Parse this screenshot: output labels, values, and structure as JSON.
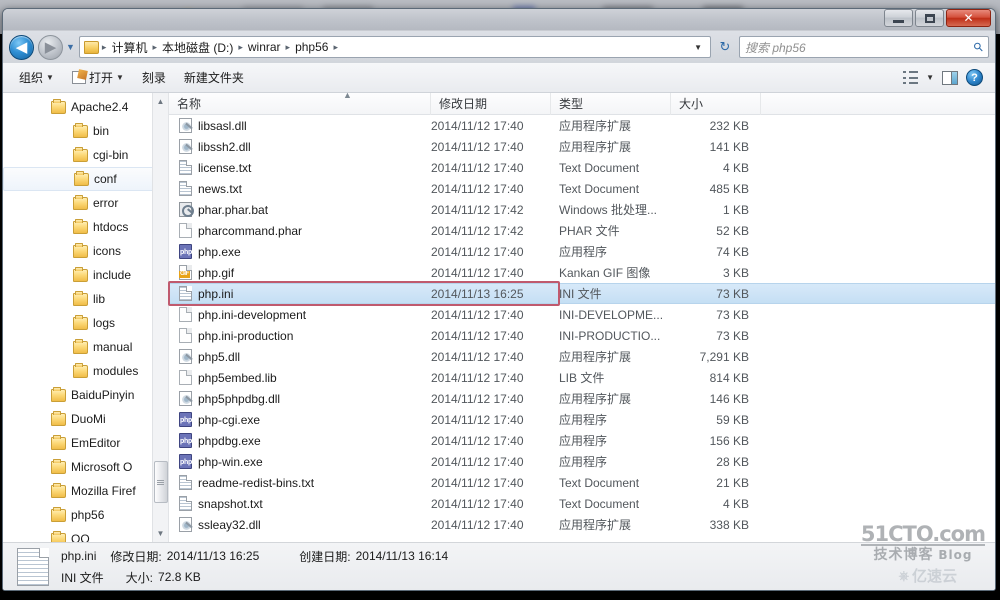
{
  "window": {
    "controls": {
      "minimize": "–",
      "maximize": "□",
      "close": "✕"
    }
  },
  "address_bar": {
    "back_label": "◀",
    "forward_label": "▶",
    "history_caret": "▼",
    "folder_icon": "folder-icon",
    "crumbs": [
      "计算机",
      "本地磁盘 (D:)",
      "winrar",
      "php56"
    ],
    "separator": "▸",
    "dropdown_caret": "▼",
    "refresh_label": "↻"
  },
  "search": {
    "placeholder": "搜索 php56",
    "icon": "search-icon"
  },
  "toolbar": {
    "organize": "组织",
    "open": "打开",
    "burn": "刻录",
    "new_folder": "新建文件夹",
    "caret": "▼",
    "view_options_caret": "▼",
    "help_label": "?"
  },
  "sidebar": {
    "items": [
      {
        "label": "Apache2.4",
        "indent": 1,
        "state": "normal"
      },
      {
        "label": "bin",
        "indent": 2,
        "state": "normal"
      },
      {
        "label": "cgi-bin",
        "indent": 2,
        "state": "normal"
      },
      {
        "label": "conf",
        "indent": 2,
        "state": "hover"
      },
      {
        "label": "error",
        "indent": 2,
        "state": "normal"
      },
      {
        "label": "htdocs",
        "indent": 2,
        "state": "normal"
      },
      {
        "label": "icons",
        "indent": 2,
        "state": "normal"
      },
      {
        "label": "include",
        "indent": 2,
        "state": "normal"
      },
      {
        "label": "lib",
        "indent": 2,
        "state": "normal"
      },
      {
        "label": "logs",
        "indent": 2,
        "state": "normal"
      },
      {
        "label": "manual",
        "indent": 2,
        "state": "normal"
      },
      {
        "label": "modules",
        "indent": 2,
        "state": "normal"
      },
      {
        "label": "BaiduPinyin",
        "indent": 1,
        "state": "normal"
      },
      {
        "label": "DuoMi",
        "indent": 1,
        "state": "normal"
      },
      {
        "label": "EmEditor",
        "indent": 1,
        "state": "normal"
      },
      {
        "label": "Microsoft O",
        "indent": 1,
        "state": "normal"
      },
      {
        "label": "Mozilla Firef",
        "indent": 1,
        "state": "normal"
      },
      {
        "label": "php56",
        "indent": 1,
        "state": "normal"
      },
      {
        "label": "QQ",
        "indent": 1,
        "state": "normal"
      }
    ],
    "scroll_up": "▲",
    "scroll_down": "▼"
  },
  "file_list": {
    "columns": [
      "名称",
      "修改日期",
      "类型",
      "大小"
    ],
    "sort_indicator": "▲",
    "rows": [
      {
        "name": "libsasl.dll",
        "date": "2014/11/12 17:40",
        "type": "应用程序扩展",
        "size": "232 KB",
        "icon": "dll",
        "selected": false
      },
      {
        "name": "libssh2.dll",
        "date": "2014/11/12 17:40",
        "type": "应用程序扩展",
        "size": "141 KB",
        "icon": "dll",
        "selected": false
      },
      {
        "name": "license.txt",
        "date": "2014/11/12 17:40",
        "type": "Text Document",
        "size": "4 KB",
        "icon": "doc",
        "selected": false
      },
      {
        "name": "news.txt",
        "date": "2014/11/12 17:40",
        "type": "Text Document",
        "size": "485 KB",
        "icon": "doc",
        "selected": false
      },
      {
        "name": "phar.phar.bat",
        "date": "2014/11/12 17:42",
        "type": "Windows 批处理...",
        "size": "1 KB",
        "icon": "bat",
        "selected": false
      },
      {
        "name": "pharcommand.phar",
        "date": "2014/11/12 17:42",
        "type": "PHAR 文件",
        "size": "52 KB",
        "icon": "blank",
        "selected": false
      },
      {
        "name": "php.exe",
        "date": "2014/11/12 17:40",
        "type": "应用程序",
        "size": "74 KB",
        "icon": "php",
        "selected": false
      },
      {
        "name": "php.gif",
        "date": "2014/11/12 17:40",
        "type": "Kankan GIF 图像",
        "size": "3 KB",
        "icon": "gif",
        "selected": false
      },
      {
        "name": "php.ini",
        "date": "2014/11/13 16:25",
        "type": "INI 文件",
        "size": "73 KB",
        "icon": "doc",
        "selected": true
      },
      {
        "name": "php.ini-development",
        "date": "2014/11/12 17:40",
        "type": "INI-DEVELOPME...",
        "size": "73 KB",
        "icon": "blank",
        "selected": false
      },
      {
        "name": "php.ini-production",
        "date": "2014/11/12 17:40",
        "type": "INI-PRODUCTIO...",
        "size": "73 KB",
        "icon": "blank",
        "selected": false
      },
      {
        "name": "php5.dll",
        "date": "2014/11/12 17:40",
        "type": "应用程序扩展",
        "size": "7,291 KB",
        "icon": "dll",
        "selected": false
      },
      {
        "name": "php5embed.lib",
        "date": "2014/11/12 17:40",
        "type": "LIB 文件",
        "size": "814 KB",
        "icon": "blank",
        "selected": false
      },
      {
        "name": "php5phpdbg.dll",
        "date": "2014/11/12 17:40",
        "type": "应用程序扩展",
        "size": "146 KB",
        "icon": "dll",
        "selected": false
      },
      {
        "name": "php-cgi.exe",
        "date": "2014/11/12 17:40",
        "type": "应用程序",
        "size": "59 KB",
        "icon": "php",
        "selected": false
      },
      {
        "name": "phpdbg.exe",
        "date": "2014/11/12 17:40",
        "type": "应用程序",
        "size": "156 KB",
        "icon": "php",
        "selected": false
      },
      {
        "name": "php-win.exe",
        "date": "2014/11/12 17:40",
        "type": "应用程序",
        "size": "28 KB",
        "icon": "php",
        "selected": false
      },
      {
        "name": "readme-redist-bins.txt",
        "date": "2014/11/12 17:40",
        "type": "Text Document",
        "size": "21 KB",
        "icon": "doc",
        "selected": false
      },
      {
        "name": "snapshot.txt",
        "date": "2014/11/12 17:40",
        "type": "Text Document",
        "size": "4 KB",
        "icon": "doc",
        "selected": false
      },
      {
        "name": "ssleay32.dll",
        "date": "2014/11/12 17:40",
        "type": "应用程序扩展",
        "size": "338 KB",
        "icon": "dll",
        "selected": false
      }
    ]
  },
  "details_pane": {
    "file_name": "php.ini",
    "modified_label": "修改日期:",
    "modified_value": "2014/11/13 16:25",
    "created_label": "创建日期:",
    "created_value": "2014/11/13 16:14",
    "file_type": "INI 文件",
    "size_label": "大小:",
    "size_value": "72.8 KB"
  },
  "watermarks": {
    "site": "51CTO.com",
    "tagline": "技术博客",
    "blog": "Blog",
    "cloud": "亿速云"
  },
  "colors": {
    "selection": "#c5dff4",
    "annotation": "#c05a6e",
    "accent": "#2d6aa8",
    "close_button": "#bf2e17"
  }
}
